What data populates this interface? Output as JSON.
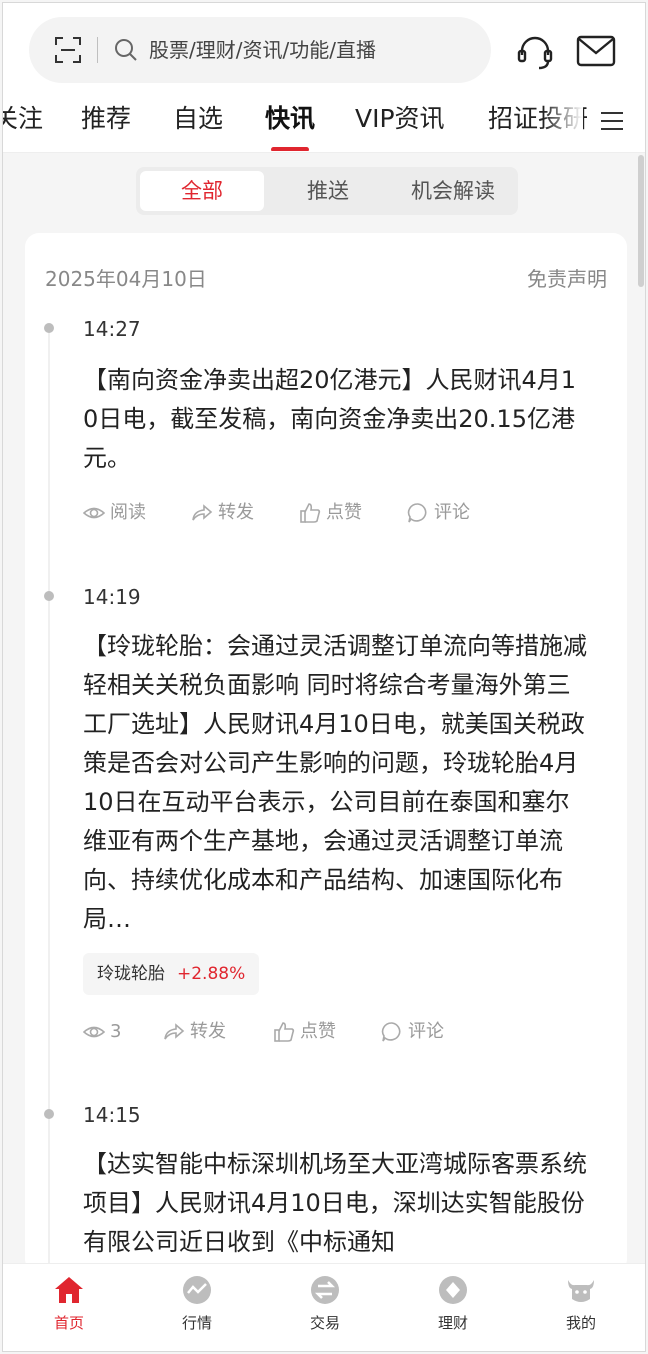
{
  "header": {
    "search_placeholder": "股票/理财/资讯/功能/直播"
  },
  "tabs": [
    {
      "label": "关注"
    },
    {
      "label": "推荐"
    },
    {
      "label": "自选"
    },
    {
      "label": "快讯"
    },
    {
      "label": "VIP资讯"
    },
    {
      "label": "招证投研"
    }
  ],
  "segment": [
    "全部",
    "推送",
    "机会解读"
  ],
  "feed": {
    "date": "2025年04月10日",
    "disclaimer": "免责声明",
    "items": [
      {
        "time": "14:27",
        "text": "【南向资金净卖出超20亿港元】人民财讯4月10日电，截至发稿，南向资金净卖出20.15亿港元。",
        "read_label": "阅读",
        "forward_label": "转发",
        "like_label": "点赞",
        "comment_label": "评论"
      },
      {
        "time": "14:19",
        "text": "【玲珑轮胎：会通过灵活调整订单流向等措施减轻相关关税负面影响 同时将综合考量海外第三工厂选址】人民财讯4月10日电，就美国关税政策是否会对公司产生影响的问题，玲珑轮胎4月10日在互动平台表示，公司目前在泰国和塞尔维亚有两个生产基地，会通过灵活调整订单流向、持续优化成本和产品结构、加速国际化布局…",
        "stock_name": "玲珑轮胎",
        "stock_change": "+2.88%",
        "read_label": "3",
        "forward_label": "转发",
        "like_label": "点赞",
        "comment_label": "评论"
      },
      {
        "time": "14:15",
        "text": "【达实智能中标深圳机场至大亚湾城际客票系统项目】人民财讯4月10日电，深圳达实智能股份有限公司近日收到《中标通知"
      }
    ]
  },
  "bottom_nav": [
    {
      "label": "首页"
    },
    {
      "label": "行情"
    },
    {
      "label": "交易"
    },
    {
      "label": "理财"
    },
    {
      "label": "我的"
    }
  ],
  "colors": {
    "accent": "#e0262f",
    "muted": "#9a9a9a"
  }
}
